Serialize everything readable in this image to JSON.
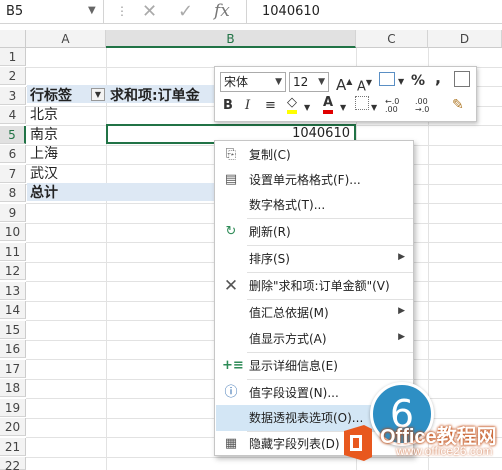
{
  "formula_bar": {
    "name_box": "B5",
    "formula": "1040610",
    "fx_label": "fx"
  },
  "columns": [
    "A",
    "B",
    "C",
    "D"
  ],
  "rows": [
    "1",
    "2",
    "3",
    "4",
    "5",
    "6",
    "7",
    "8",
    "9",
    "10",
    "11",
    "12",
    "13",
    "14",
    "15",
    "16",
    "17",
    "18",
    "19",
    "20",
    "21",
    "22"
  ],
  "pivot": {
    "row_label_header": "行标签",
    "value_header": "求和项:订单金",
    "items": [
      "北京",
      "南京",
      "上海",
      "武汉"
    ],
    "total_label": "总计",
    "selected_value": "1040610"
  },
  "mini_toolbar": {
    "font_name": "宋体",
    "font_size": "12",
    "grow_font": "A",
    "shrink_font": "A",
    "percent": "%",
    "comma": ",",
    "bold": "B",
    "italic": "I",
    "font_color_letter": "A",
    "dec_increase": "←.0 .00",
    "dec_decrease": ".00 →.0"
  },
  "context_menu": [
    {
      "label": "复制(C)",
      "icon": "copy-icon",
      "submenu": false
    },
    {
      "label": "设置单元格格式(F)...",
      "icon": "format-cells-icon",
      "submenu": false
    },
    {
      "label": "数字格式(T)...",
      "icon": "",
      "submenu": false
    },
    {
      "label": "刷新(R)",
      "icon": "refresh-icon",
      "submenu": false
    },
    {
      "label": "排序(S)",
      "icon": "",
      "submenu": true
    },
    {
      "label": "删除\"求和项:订单金额\"(V)",
      "icon": "delete-x-icon",
      "submenu": false
    },
    {
      "label": "值汇总依据(M)",
      "icon": "",
      "submenu": true
    },
    {
      "label": "值显示方式(A)",
      "icon": "",
      "submenu": true
    },
    {
      "label": "显示详细信息(E)",
      "icon": "show-details-icon",
      "submenu": false
    },
    {
      "label": "值字段设置(N)...",
      "icon": "field-settings-icon",
      "submenu": false
    },
    {
      "label": "数据透视表选项(O)...",
      "icon": "",
      "submenu": false
    },
    {
      "label": "隐藏字段列表(D)",
      "icon": "field-list-icon",
      "submenu": false
    }
  ],
  "step_badge": "6",
  "watermark": {
    "brand": "Office教程网",
    "url": "www.office26.com"
  },
  "colors": {
    "accent_green": "#217346",
    "highlight": "#d3e6f5",
    "pivot_header": "#dde8f4",
    "badge": "#2e8fc4",
    "logo": "#e8581e"
  }
}
